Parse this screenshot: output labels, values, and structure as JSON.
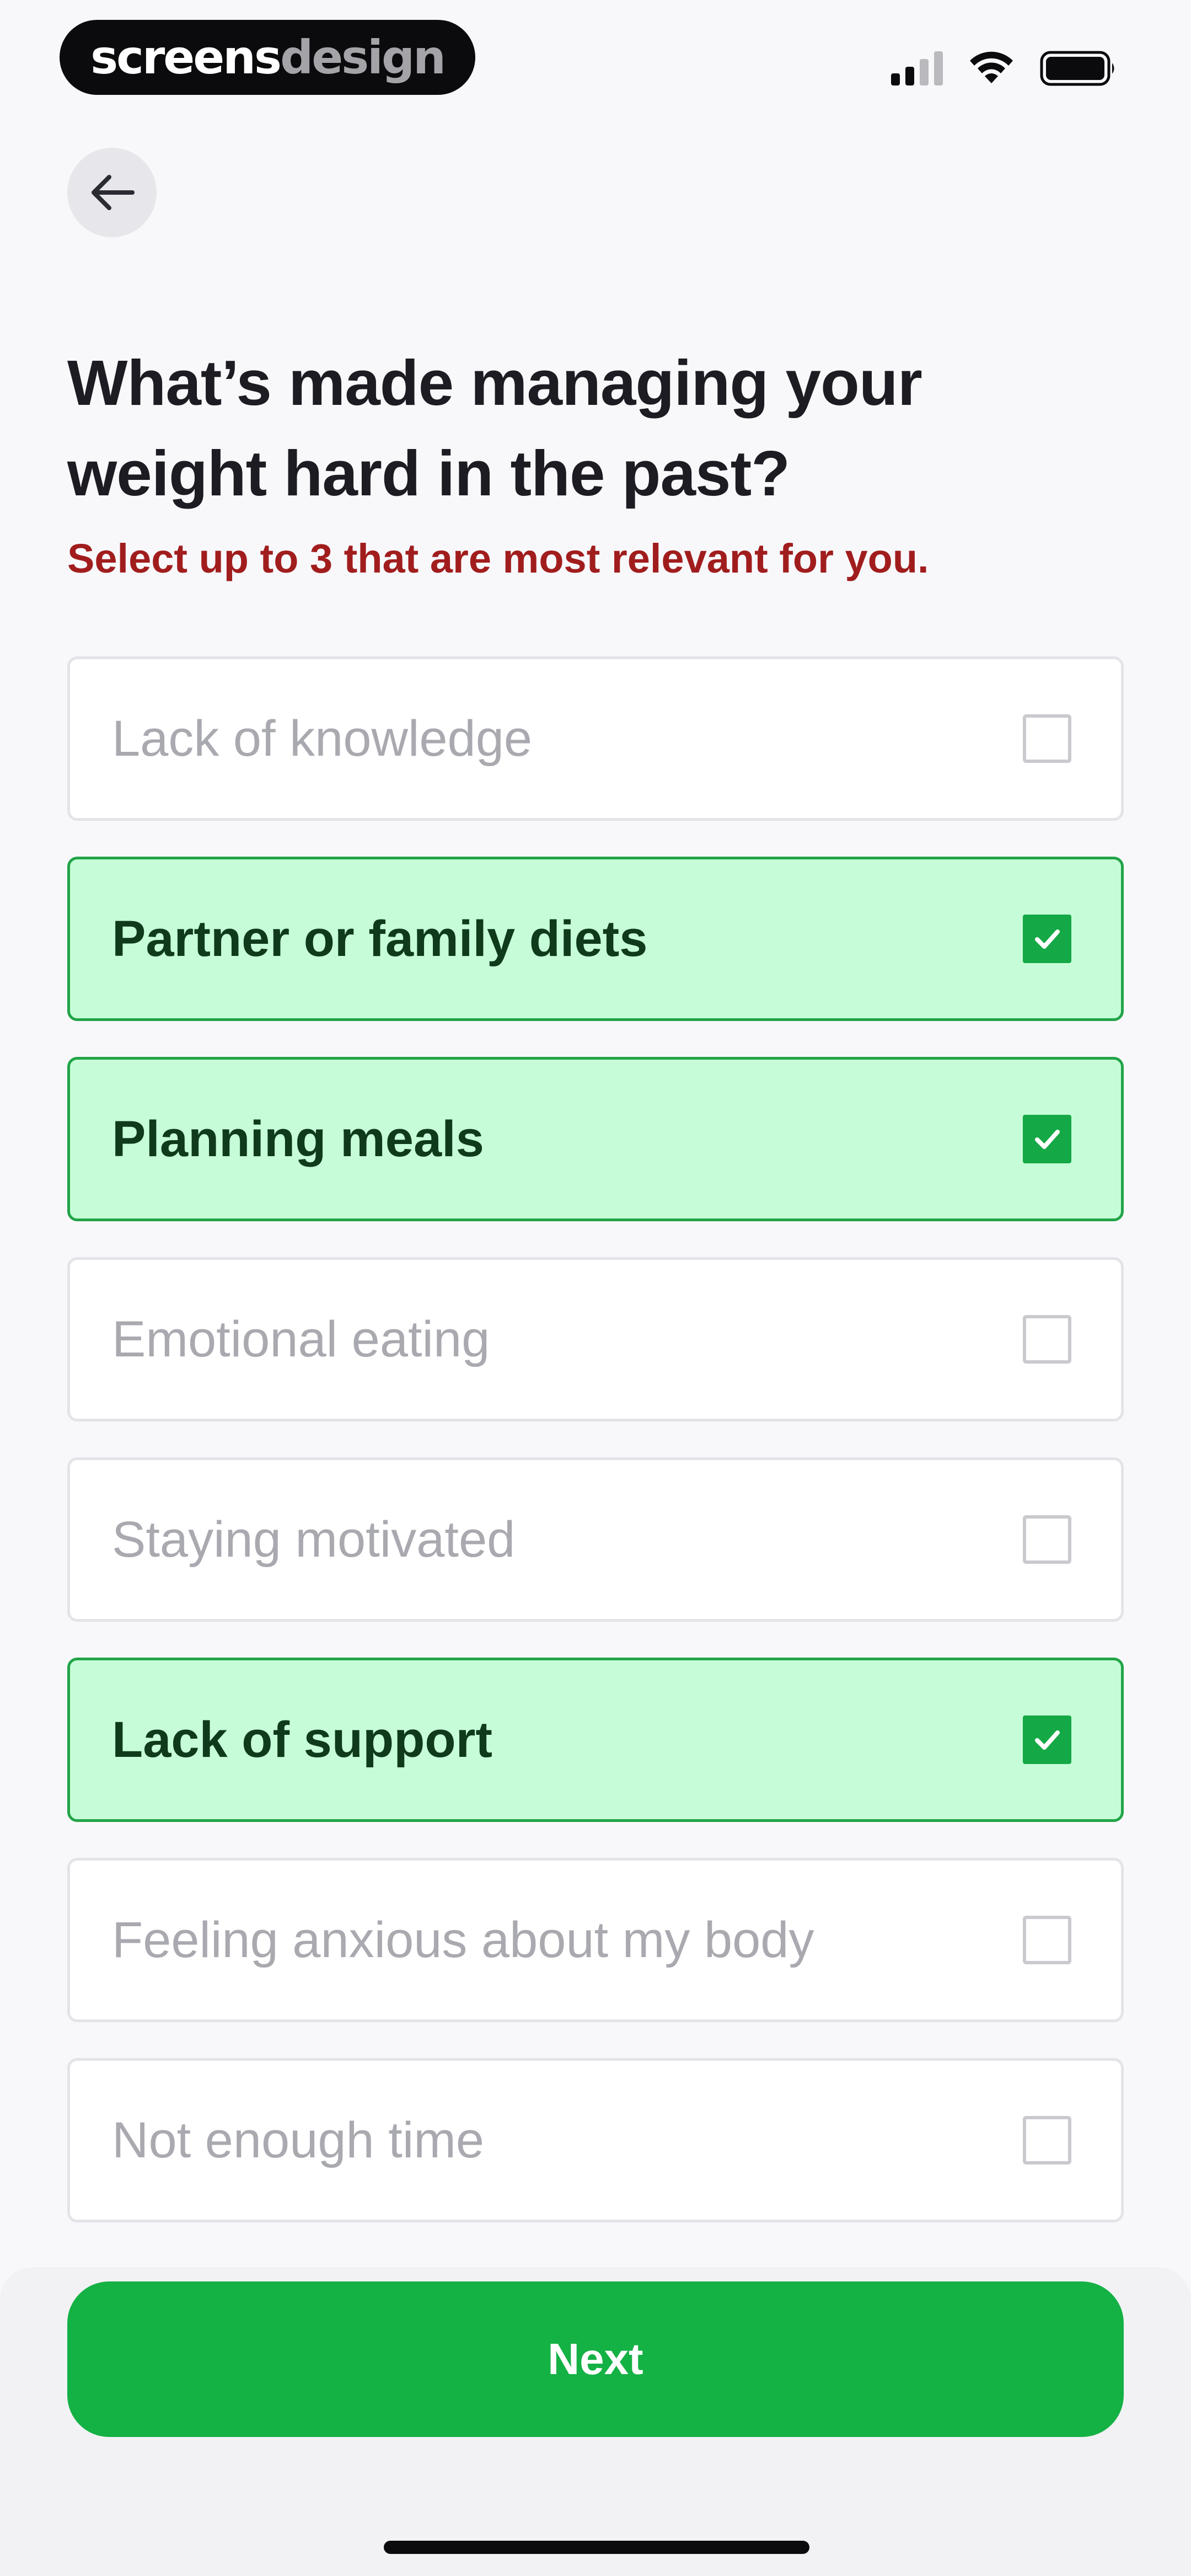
{
  "status_bar": {
    "brand_part1": "screens",
    "brand_part2": "design",
    "icons": [
      "cellular-signal-icon",
      "wifi-icon",
      "battery-icon"
    ]
  },
  "header": {
    "back_icon": "arrow-left-icon"
  },
  "question": {
    "title": "What’s made managing your weight hard in the past?",
    "subtitle": "Select up to 3 that are most relevant for you."
  },
  "options": [
    {
      "label": "Lack of knowledge",
      "selected": false
    },
    {
      "label": "Partner or family diets",
      "selected": true
    },
    {
      "label": "Planning meals",
      "selected": true
    },
    {
      "label": "Emotional eating",
      "selected": false
    },
    {
      "label": "Staying motivated",
      "selected": false
    },
    {
      "label": "Lack of support",
      "selected": true
    },
    {
      "label": "Feeling anxious about my body",
      "selected": false
    },
    {
      "label": "Not enough time",
      "selected": false
    }
  ],
  "footer": {
    "next_label": "Next"
  },
  "colors": {
    "accent_green": "#14b144",
    "selected_bg": "#c6fdd8",
    "selected_border": "#22a447",
    "subtitle_red": "#a11d1d"
  }
}
